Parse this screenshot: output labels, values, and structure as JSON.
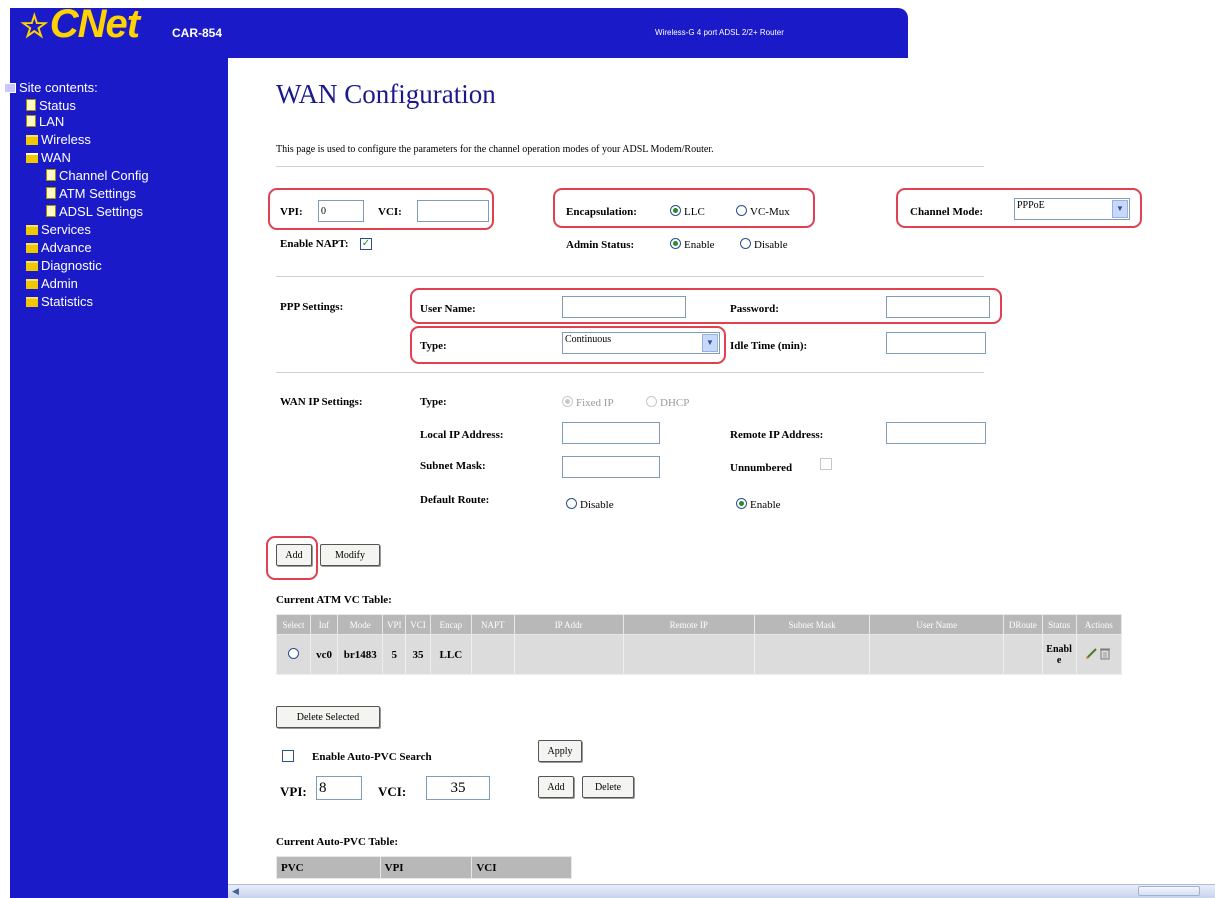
{
  "header": {
    "logo_star": "☆",
    "logo_text": "CNet",
    "model": "CAR-854",
    "product": "Wireless-G 4 port ADSL 2/2+ Router"
  },
  "sidebar": {
    "root": "Site contents:",
    "items": [
      {
        "label": "Status"
      },
      {
        "label": "LAN"
      },
      {
        "label": "Wireless"
      },
      {
        "label": "WAN"
      },
      {
        "label": "Channel Config"
      },
      {
        "label": "ATM Settings"
      },
      {
        "label": "ADSL Settings"
      },
      {
        "label": "Services"
      },
      {
        "label": "Advance"
      },
      {
        "label": "Diagnostic"
      },
      {
        "label": "Admin"
      },
      {
        "label": "Statistics"
      }
    ]
  },
  "page": {
    "title": "WAN Configuration",
    "description": "This page is used to configure the parameters for the channel operation modes of your ADSL Modem/Router."
  },
  "channel": {
    "vpi_label": "VPI:",
    "vpi_value": "0",
    "vci_label": "VCI:",
    "vci_value": "",
    "encap_label": "Encapsulation:",
    "encap_llc": "LLC",
    "encap_vcmux": "VC-Mux",
    "mode_label": "Channel Mode:",
    "mode_value": "PPPoE",
    "napt_label": "Enable NAPT:",
    "napt_checked": true,
    "admin_label": "Admin Status:",
    "admin_enable": "Enable",
    "admin_disable": "Disable"
  },
  "ppp": {
    "section_label": "PPP Settings:",
    "user_label": "User Name:",
    "user_value": "",
    "password_label": "Password:",
    "password_value": "",
    "type_label": "Type:",
    "type_value": "Continuous",
    "idle_label": "Idle Time (min):",
    "idle_value": ""
  },
  "wanip": {
    "section_label": "WAN IP Settings:",
    "type_label": "Type:",
    "type_fixed": "Fixed IP",
    "type_dhcp": "DHCP",
    "local_ip_label": "Local IP Address:",
    "local_ip_value": "",
    "remote_ip_label": "Remote IP Address:",
    "remote_ip_value": "",
    "subnet_label": "Subnet Mask:",
    "subnet_value": "",
    "unnumbered_label": "Unnumbered",
    "default_route_label": "Default Route:",
    "route_disable": "Disable",
    "route_enable": "Enable"
  },
  "buttons": {
    "add": "Add",
    "modify": "Modify",
    "delete_selected": "Delete Selected",
    "apply": "Apply",
    "pvc_add": "Add",
    "pvc_delete": "Delete"
  },
  "atm_table": {
    "title": "Current ATM VC Table:",
    "headers": [
      "Select",
      "Inf",
      "Mode",
      "VPI",
      "VCI",
      "Encap",
      "NAPT",
      "IP Addr",
      "Remote IP",
      "Subnet Mask",
      "User Name",
      "DRoute",
      "Status",
      "Actions"
    ],
    "rows": [
      {
        "inf": "vc0",
        "mode": "br1483",
        "vpi": "5",
        "vci": "35",
        "encap": "LLC",
        "napt": "",
        "ip": "",
        "remote": "",
        "mask": "",
        "user": "",
        "droute": "",
        "status": "Enable"
      }
    ]
  },
  "auto_pvc": {
    "enable_label": "Enable Auto-PVC Search",
    "vpi_label": "VPI:",
    "vpi_value": "8",
    "vci_label": "VCI:",
    "vci_value": "35",
    "table_title": "Current Auto-PVC Table:",
    "headers": [
      "PVC",
      "VPI",
      "VCI"
    ]
  },
  "colors": {
    "header_blue": "#1a1ac8",
    "logo_yellow": "#ffd200",
    "highlight_red": "#e04050",
    "title_navy": "#1a1a8c"
  }
}
